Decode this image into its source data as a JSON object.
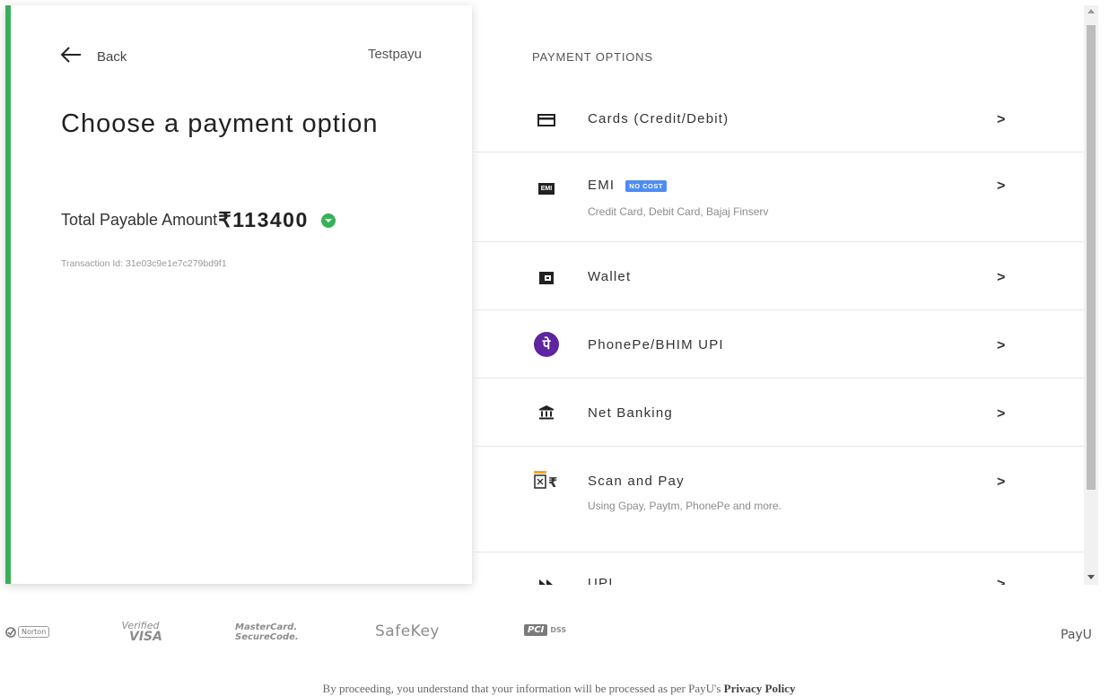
{
  "header": {
    "back_label": "Back",
    "merchant_name": "Testpayu",
    "title": "Choose a payment option"
  },
  "amount": {
    "label": "Total Payable Amount",
    "value": "₹113400"
  },
  "transaction": {
    "label": "Transaction Id: 31e03c9e1e7c279bd9f1"
  },
  "payment_options": {
    "title": "PAYMENT OPTIONS",
    "items": [
      {
        "label": "Cards (Credit/Debit)",
        "icon": "card-icon"
      },
      {
        "label": "EMI",
        "badge": "NO COST",
        "subtitle": "Credit Card, Debit Card, Bajaj Finserv",
        "icon": "emi-icon",
        "icon_text": "EMI"
      },
      {
        "label": "Wallet",
        "icon": "wallet-icon"
      },
      {
        "label": "PhonePe/BHIM UPI",
        "icon": "phonepe-icon",
        "icon_text": "पे"
      },
      {
        "label": "Net Banking",
        "icon": "bank-icon"
      },
      {
        "label": "Scan and Pay",
        "subtitle": "Using Gpay, Paytm, PhonePe and more.",
        "icon": "qr-rupee-icon"
      },
      {
        "label": "UPI",
        "icon": "upi-icon"
      }
    ],
    "chevron": ">"
  },
  "footer": {
    "logos": {
      "norton": "Norton",
      "visa_top": "Verified",
      "visa_bottom": "VISA",
      "mc_top": "MasterCard.",
      "mc_bottom": "SecureCode.",
      "safekey": "SafeKey",
      "pci": "PCI",
      "pci_dss": "DSS",
      "payu": "PayU"
    },
    "consent_text": "By proceeding, you understand that your information will be processed as per PayU's",
    "privacy_link": "Privacy Policy"
  },
  "colors": {
    "accent_green": "#37b05a",
    "badge_blue": "#4e8df5",
    "phonepe_purple": "#5f259f"
  }
}
